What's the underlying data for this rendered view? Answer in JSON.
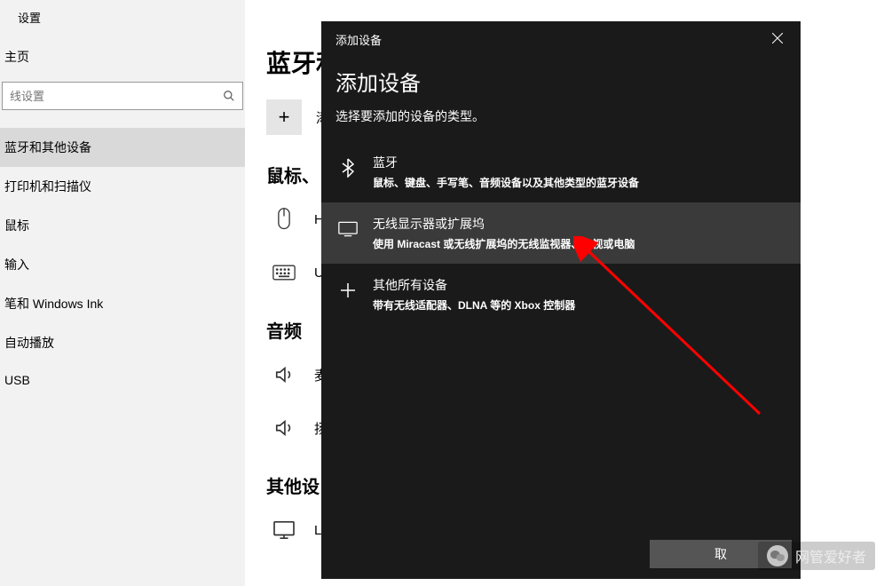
{
  "settings": {
    "title": "设置",
    "home": "主页",
    "search_placeholder": "线设置",
    "sidebar": [
      "蓝牙和其他设备",
      "打印机和扫描仪",
      "鼠标",
      "输入",
      "笔和 Windows Ink",
      "自动播放",
      "USB"
    ]
  },
  "main": {
    "title": "蓝牙和",
    "add_device_label": "添",
    "sections": {
      "mouse": "鼠标、",
      "mouse_item": "HP",
      "keyboard_item": "US",
      "audio": "音频",
      "audio_item1": "麦",
      "audio_item2": "扬",
      "other": "其他设",
      "other_item": "LE"
    }
  },
  "dialog": {
    "header": "添加设备",
    "title": "添加设备",
    "subtitle": "选择要添加的设备的类型。",
    "footer_btn": "取",
    "options": [
      {
        "title": "蓝牙",
        "desc": "鼠标、键盘、手写笔、音频设备以及其他类型的蓝牙设备"
      },
      {
        "title": "无线显示器或扩展坞",
        "desc": "使用 Miracast 或无线扩展坞的无线监视器、电视或电脑"
      },
      {
        "title": "其他所有设备",
        "desc": "带有无线适配器、DLNA 等的 Xbox 控制器"
      }
    ]
  },
  "watermark": "网管爱好者"
}
